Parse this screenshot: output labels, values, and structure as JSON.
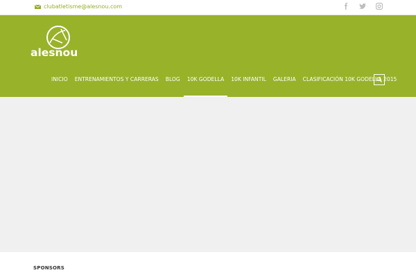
{
  "topbar": {
    "email": "clubatletisme@alesnou.com",
    "social_icons": [
      "facebook-icon",
      "twitter-icon",
      "instagram-icon"
    ]
  },
  "brand": {
    "logo_text": "alesnou",
    "colors": {
      "accent": "#98b22a",
      "link": "#94ad27",
      "hero_bg": "#f0f0f0"
    }
  },
  "nav": {
    "items": [
      {
        "label": "INICIO"
      },
      {
        "label": "ENTRENAMIENTOS Y CARRERAS"
      },
      {
        "label": "BLOG"
      },
      {
        "label": "10K GODELLA",
        "active": true
      },
      {
        "label": "10K INFANTIL"
      },
      {
        "label": "GALERIA"
      },
      {
        "label": "CLASIFICACIÓN 10K GODELLA 2015"
      }
    ],
    "search_icon": "search-icon"
  },
  "footer": {
    "sponsors_heading": "SPONSORS"
  }
}
